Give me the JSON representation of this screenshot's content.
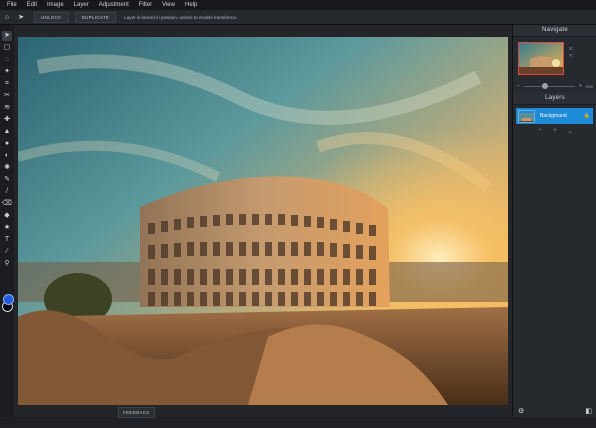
{
  "menubar": {
    "items": [
      "File",
      "Edit",
      "Image",
      "Layer",
      "Adjustment",
      "Filter",
      "View",
      "Help"
    ]
  },
  "options": {
    "unlock_label": "UNLOCK",
    "duplicate_label": "DUPLICATE",
    "message": "Layer is locked in position, unlock to enable transforms."
  },
  "navigate": {
    "title": "Navigate",
    "x_label": "X:",
    "y_label": "Y:",
    "zoom": "75%",
    "minus": "−",
    "plus": "+"
  },
  "layers": {
    "title": "Layers",
    "items": [
      {
        "name": "Background",
        "locked": true
      }
    ]
  },
  "feedback_label": "FEEDBACK",
  "colors": {
    "foreground": "#1e59d9",
    "background": "#000000",
    "layer_selected": "#1d8ad6"
  }
}
